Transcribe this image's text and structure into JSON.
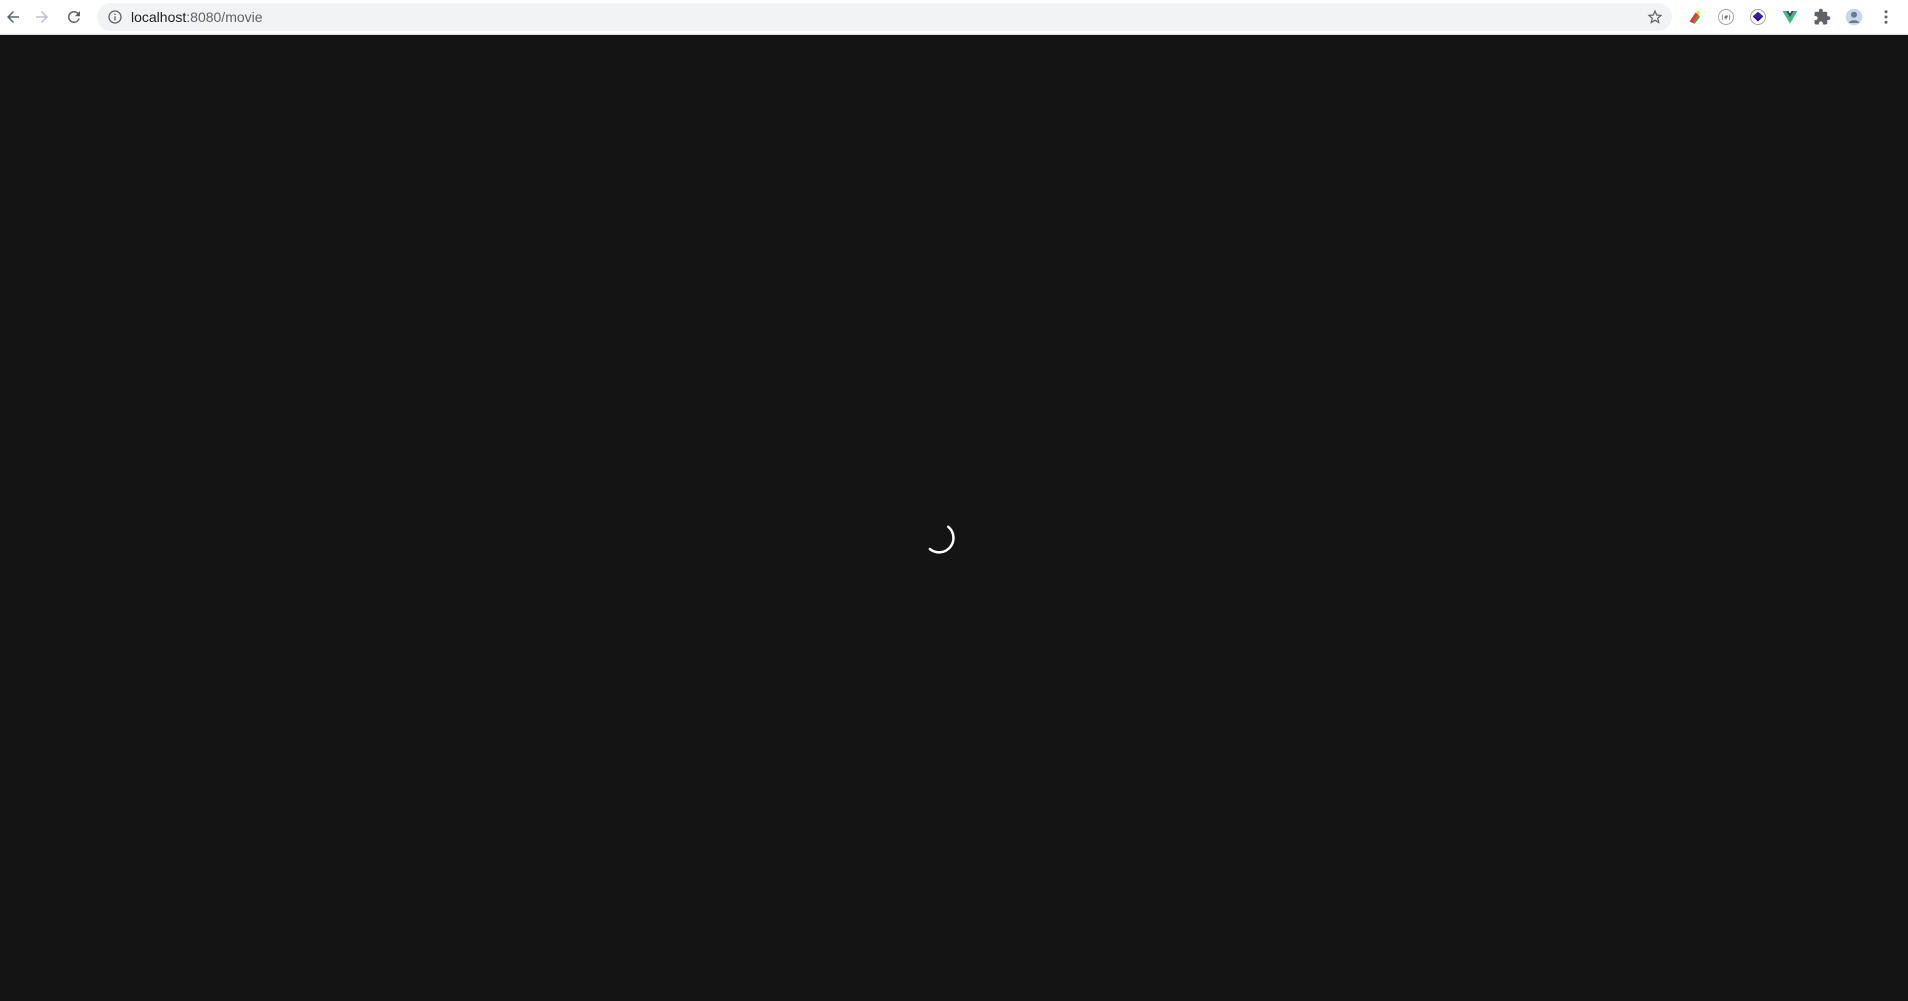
{
  "browser": {
    "url_host": "localhost",
    "url_path": ":8080/movie",
    "icons": {
      "back": "back-arrow-icon",
      "forward": "forward-arrow-icon",
      "reload": "reload-icon",
      "site_info": "info-icon",
      "bookmark": "star-icon",
      "extensions": [
        "extension-color-icon",
        "extension-json-icon",
        "extension-purple-icon",
        "extension-vue-icon",
        "puzzle-icon"
      ],
      "profile": "avatar",
      "menu": "kebab-menu-icon"
    }
  },
  "page": {
    "background_color": "#141414",
    "loading": true,
    "spinner_color": "#ffffff"
  }
}
